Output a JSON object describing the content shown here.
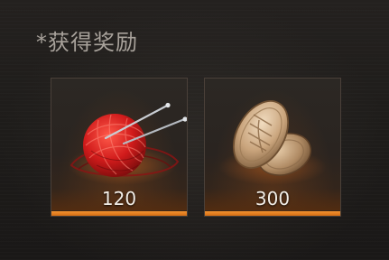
{
  "header": {
    "title": "*获得奖励"
  },
  "rewards": [
    {
      "icon": "red-yarn-ball-icon",
      "count": "120"
    },
    {
      "icon": "oval-gold-coins-icon",
      "count": "300"
    }
  ],
  "colors": {
    "accent": "#e07a1e",
    "title_text": "#a8a29b",
    "count_text": "#f2ede6",
    "background": "#1e1c1a"
  }
}
